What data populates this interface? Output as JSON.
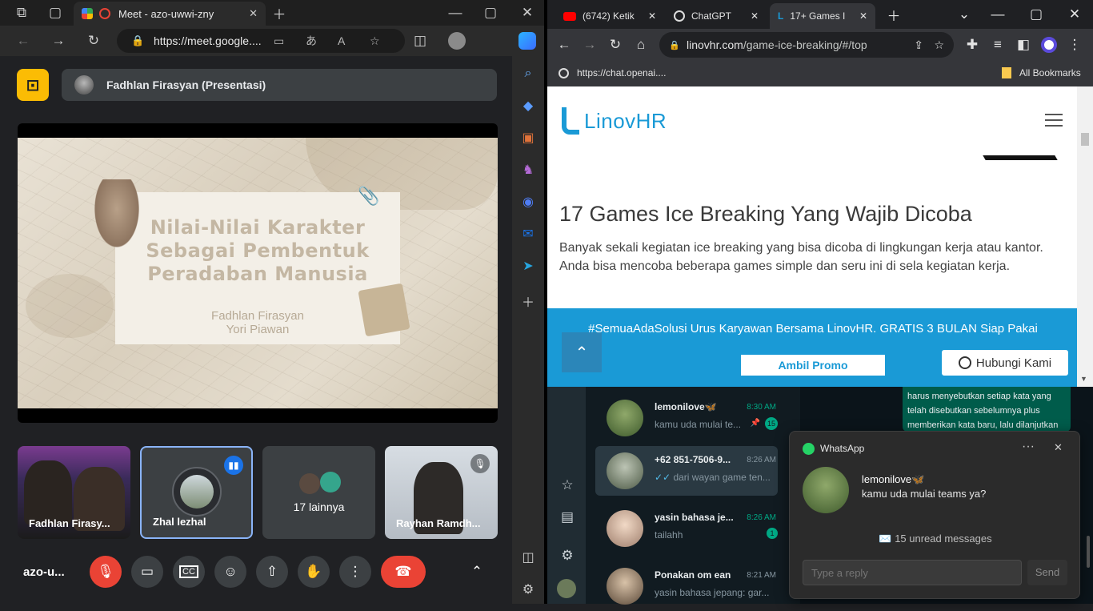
{
  "edge": {
    "tab_title": "Meet - azo-uwwi-zny",
    "address": "https://meet.google....",
    "sidebar_icons": [
      "search-icon",
      "tag-icon",
      "briefcase-icon",
      "chess-icon",
      "copilot-icon",
      "outlook-icon",
      "send-icon",
      "plus-icon"
    ]
  },
  "meet": {
    "presenter_label": "Fadhlan Firasyan (Presentasi)",
    "slide": {
      "title_line1": "Nilai-Nilai Karakter",
      "title_line2": "Sebagai Pembentuk",
      "title_line3": "Peradaban Manusia",
      "author1": "Fadhlan Firasyan",
      "author2": "Yori Piawan"
    },
    "tiles": [
      {
        "name": "Fadhlan Firasy..."
      },
      {
        "name": "Zhal lezhal"
      },
      {
        "name": "17 lainnya"
      },
      {
        "name": "Rayhan Ramdh..."
      }
    ],
    "meeting_code": "azo-u..."
  },
  "chrome": {
    "tabs": [
      "(6742) Ketik",
      "ChatGPT",
      "17+ Games I"
    ],
    "address_domain": "linovhr.com",
    "address_path": "/game-ice-breaking/#/top",
    "bookmark": "https://chat.openai....",
    "all_bookmarks": "All Bookmarks"
  },
  "article": {
    "logo": "LinovHR",
    "heading": "17 Games Ice Breaking Yang Wajib Dicoba",
    "intro": "Banyak sekali kegiatan ice breaking yang bisa dicoba di lingkungan kerja atau kantor. Anda bisa mencoba beberapa games simple dan seru ini di sela kegiatan kerja.",
    "promo_text": "#SemuaAdaSolusi Urus Karyawan Bersama LinovHR. GRATIS 3 BULAN Siap Pakai",
    "promo_button": "Ambil Promo",
    "contact_button": "Hubungi Kami"
  },
  "whatsapp": {
    "chats": [
      {
        "name": "lemonilove🦋",
        "time": "8:30 AM",
        "msg": "kamu uda mulai te...",
        "unread": "15"
      },
      {
        "name": "+62 851-7506-9...",
        "time": "8:26 AM",
        "msg": "dari wayan game ten..."
      },
      {
        "name": "yasin bahasa je...",
        "time": "8:26 AM",
        "msg": "tailahh",
        "unread": "1"
      },
      {
        "name": "Ponakan om ean",
        "time": "8:21 AM",
        "msg": "yasin bahasa jepang: gar..."
      }
    ],
    "bubble": "harus menyebutkan setiap kata yang telah disebutkan sebelumnya plus memberikan kata baru, lalu dilanjutkan ke belakang sampai"
  },
  "notification": {
    "app": "WhatsApp",
    "sender": "lemonilove🦋",
    "message": "kamu uda mulai teams ya?",
    "unread": "✉️ 15 unread messages",
    "reply_placeholder": "Type a reply",
    "send_label": "Send"
  }
}
